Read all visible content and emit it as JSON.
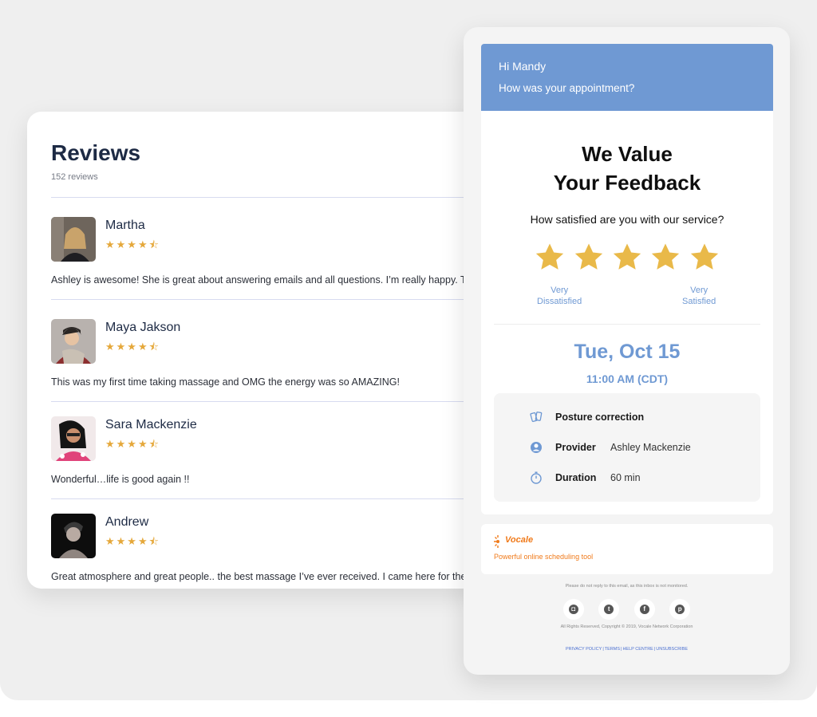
{
  "reviews": {
    "title": "Reviews",
    "count": "152 reviews",
    "items": [
      {
        "name": "Martha",
        "stars": "★★★★⯪",
        "text": "Ashley is awesome! She is great about answering emails and all questions. I’m really happy. Th"
      },
      {
        "name": "Maya Jakson",
        "stars": "★★★★⯪",
        "text": "This was my first time taking massage and OMG the energy was so AMAZING!"
      },
      {
        "name": "Sara Mackenzie",
        "stars": "★★★★⯪",
        "text": "Wonderful…life is good again !!"
      },
      {
        "name": "Andrew",
        "stars": "★★★★⯪",
        "text": "Great atmosphere and great people.. the best massage I’ve ever received. I came here for the fi"
      }
    ]
  },
  "email": {
    "greeting": "Hi Mandy",
    "question": "How was your appointment?",
    "headline_line1": "We Value",
    "headline_line2": "Your Feedback",
    "satisfaction_question": "How satisfied are you with our service?",
    "rating_stars": 5,
    "scale_low_1": "Very",
    "scale_low_2": "Dissatisfied",
    "scale_high_1": "Very",
    "scale_high_2": "Satisfied",
    "date": "Tue, Oct 15",
    "time": "11:00 AM (CDT)",
    "details": {
      "service": "Posture correction",
      "provider_label": "Provider",
      "provider_value": "Ashley Mackenzie",
      "duration_label": "Duration",
      "duration_value": "60 min"
    },
    "brand": {
      "name": "Vocale",
      "tagline": "Powerful online scheduling tool"
    },
    "footer": {
      "noreply": "Please do not reply to this email, as this inbox is not monitored.",
      "copyright": "All Rights Reserved, Copyright © 2019, Vocale Network Corporation",
      "privacy": "PRIVACY POLICY",
      "terms": "TERMS",
      "help": "HELP CENTRE",
      "unsubscribe": "UNSUBSCRIBE"
    },
    "socials": [
      "instagram-icon",
      "twitter-icon",
      "facebook-icon",
      "pinterest-icon"
    ],
    "colors": {
      "accent": "#6f99d3",
      "star": "#e9b949",
      "brand": "#f07a1a"
    }
  }
}
